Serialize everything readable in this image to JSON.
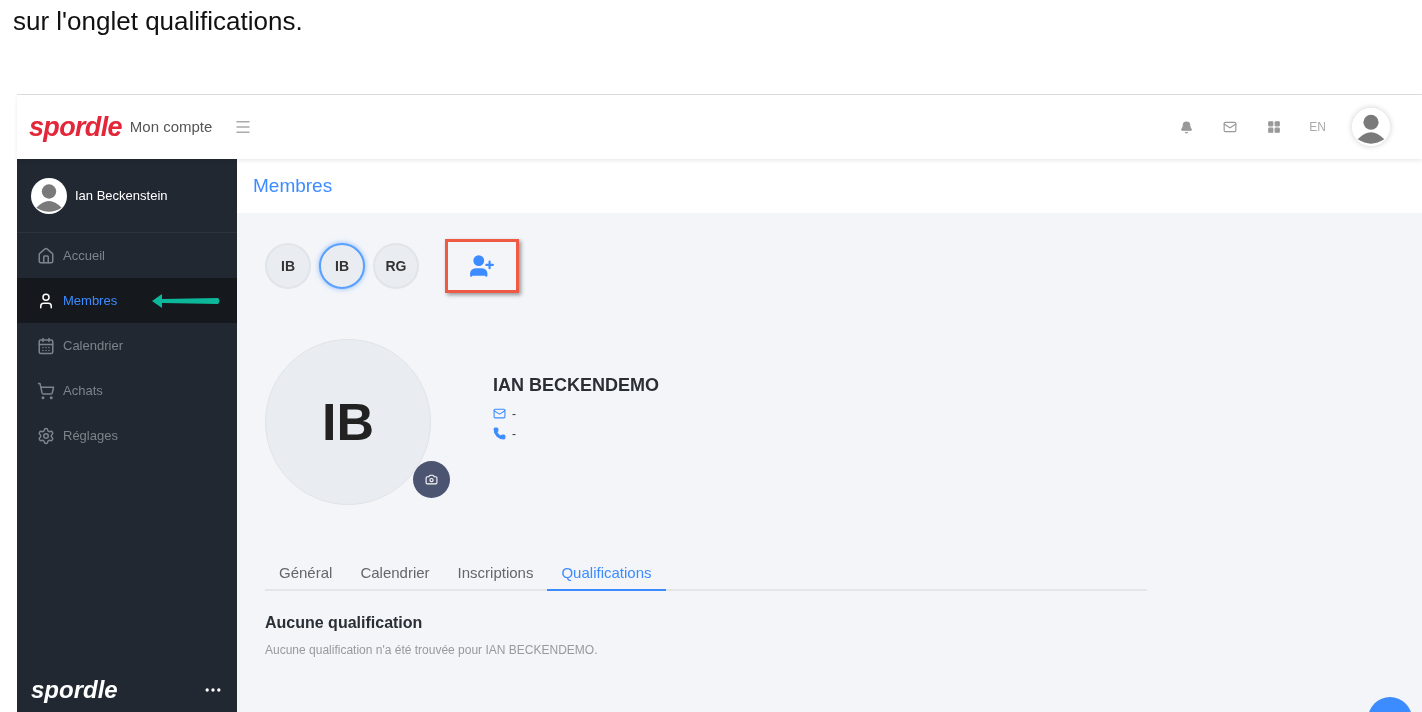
{
  "caption": "sur l'onglet qualifications.",
  "header": {
    "logo": "spordle",
    "app_name": "Mon compte",
    "language": "EN"
  },
  "sidebar": {
    "user_name": "Ian Beckenstein",
    "items": [
      {
        "label": "Accueil",
        "selected": false,
        "arrow": false
      },
      {
        "label": "Membres",
        "selected": true,
        "arrow": true
      },
      {
        "label": "Calendrier",
        "selected": false,
        "arrow": false
      },
      {
        "label": "Achats",
        "selected": false,
        "arrow": false
      },
      {
        "label": "Réglages",
        "selected": false,
        "arrow": false
      }
    ],
    "footer_logo": "spordle"
  },
  "page_title": "Membres",
  "members": [
    {
      "initials": "IB",
      "selected": false
    },
    {
      "initials": "IB",
      "selected": true
    },
    {
      "initials": "RG",
      "selected": false
    }
  ],
  "add_member": {
    "highlighted": true
  },
  "profile": {
    "initials": "IB",
    "name": "IAN BECKENDEMO",
    "email": "-",
    "phone": "-"
  },
  "tabs": [
    {
      "label": "Général",
      "selected": false
    },
    {
      "label": "Calendrier",
      "selected": false
    },
    {
      "label": "Inscriptions",
      "selected": false
    },
    {
      "label": "Qualifications",
      "selected": true
    }
  ],
  "empty_state": {
    "title": "Aucune qualification",
    "message": "Aucune qualification n'a été trouvée pour IAN BECKENDEMO."
  }
}
